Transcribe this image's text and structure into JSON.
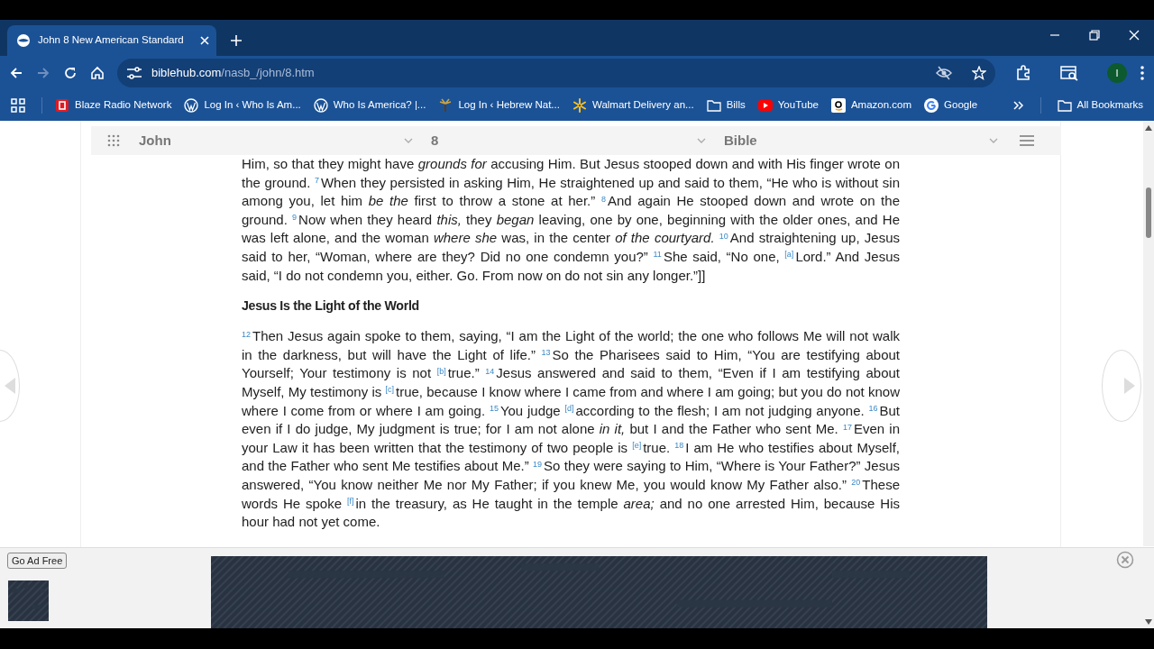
{
  "browser": {
    "tab": {
      "title": "John 8 New American Standard",
      "selected": true
    },
    "url": {
      "domain": "biblehub.com",
      "path": "/nasb_/john/8.htm"
    },
    "profile_initial": "I",
    "bookmarks": [
      {
        "kind": "blaze",
        "label": "Blaze Radio Network"
      },
      {
        "kind": "wordpress",
        "label": "Log In ‹ Who Is Am..."
      },
      {
        "kind": "wordpress",
        "label": "Who Is America? |..."
      },
      {
        "kind": "palm",
        "label": "Log In ‹ Hebrew Nat..."
      },
      {
        "kind": "walmart",
        "label": "Walmart Delivery an..."
      },
      {
        "kind": "folder",
        "label": "Bills"
      },
      {
        "kind": "youtube",
        "label": "YouTube"
      },
      {
        "kind": "amazon",
        "label": "Amazon.com"
      },
      {
        "kind": "google",
        "label": "Google"
      }
    ],
    "all_bookmarks": "All Bookmarks"
  },
  "page_nav": {
    "book": "John",
    "chapter": "8",
    "version": "Bible"
  },
  "passage": [
    {
      "kind": "paragraph",
      "text": "Him, so that they might have *grounds for* accusing Him. But Jesus stooped down and with His finger wrote on the ground. $^{7}$When they persisted in asking Him, He straightened up and said to them, “He who is without sin among you, let him *be the* first to throw a stone at her.” $^{8}$And again He stooped down and wrote on the ground. $^{9}$Now when they heard *this,* they *began* leaving, one by one, beginning with the older ones, and He was left alone, and the woman *where she* was, in the center *of the courtyard.* $^{10}$And straightening up, Jesus said to her, “Woman, where are they? Did no one condemn you?” $^{11}$She said, “No one, $^{[a]}$Lord.” And Jesus said, “I do not condemn you, either. Go. From now on do not sin any longer.”]]"
    },
    {
      "kind": "heading",
      "text": "Jesus Is the Light of the World"
    },
    {
      "kind": "paragraph",
      "text": "$^{12}$Then Jesus again spoke to them, saying, “I am the Light of the world; the one who follows Me will not walk in the darkness, but will have the Light of life.” $^{13}$So the Pharisees said to Him, “You are testifying about Yourself; Your testimony is not $^{[b]}$true.” $^{14}$Jesus answered and said to them, “Even if I am testifying about Myself, My testimony is $^{[c]}$true, because I know where I came from and where I am going; but you do not know where I come from or where I am going. $^{15}$You judge $^{[d]}$according to the flesh; I am not judging anyone. $^{16}$But even if I do judge, My judgment is true; for I am not alone *in it,* but I and the Father who sent Me. $^{17}$Even in your Law it has been written that the testimony of two people is $^{[e]}$true. $^{18}$I am He who testifies about Myself, and the Father who sent Me testifies about Me.” $^{19}$So they were saying to Him, “Where is Your Father?” Jesus answered, “You know neither Me nor My Father; if you knew Me, you would know My Father also.” $^{20}$These words He spoke $^{[f]}$in the treasury, as He taught in the temple *area;* and no one arrested Him, because His hour had not yet come."
    }
  ],
  "ad": {
    "button": "Go Ad Free"
  }
}
